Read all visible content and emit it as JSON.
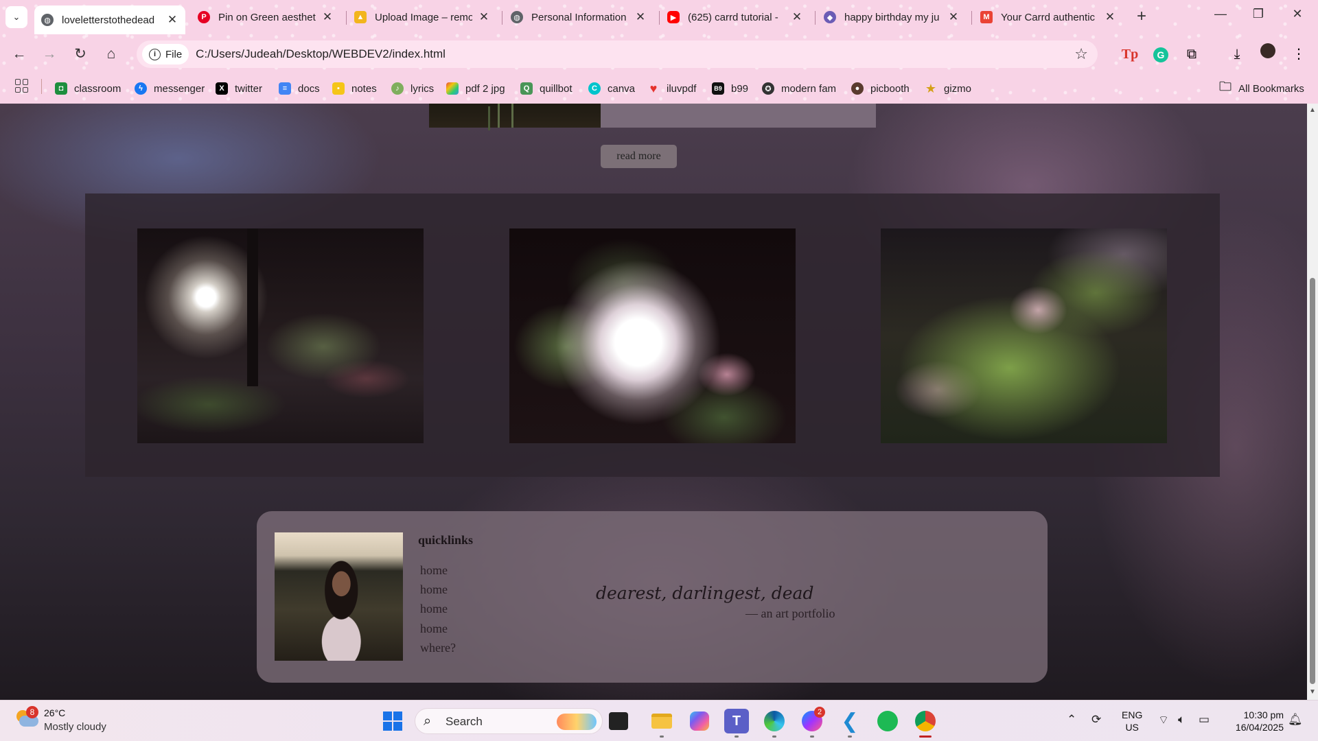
{
  "browser": {
    "tabs": [
      {
        "title": "loveletterstothedead",
        "active": true,
        "icon": "globe-icon",
        "color": "#5f6368"
      },
      {
        "title": "Pin on Green aesthet",
        "active": false,
        "icon": "pinterest-icon",
        "color": "#e60023"
      },
      {
        "title": "Upload Image – remo",
        "active": false,
        "icon": "upload-icon",
        "color": "#f2b51d"
      },
      {
        "title": "Personal Information",
        "active": false,
        "icon": "globe-icon",
        "color": "#5f6368"
      },
      {
        "title": "(625) carrd tutorial -",
        "active": false,
        "icon": "youtube-icon",
        "color": "#ff0000"
      },
      {
        "title": "happy birthday my ju",
        "active": false,
        "icon": "app-icon",
        "color": "#6b5cb5"
      },
      {
        "title": "Your Carrd authentic",
        "active": false,
        "icon": "gmail-icon",
        "color": "#ea4335"
      }
    ],
    "address": {
      "chip_label": "File",
      "url": "C:/Users/Judeah/Desktop/WEBDEV2/index.html"
    },
    "bookmarks": [
      {
        "label": "classroom",
        "icon": "classroom-icon",
        "color": "#1e8e3e"
      },
      {
        "label": "messenger",
        "icon": "messenger-icon",
        "color": "#1877f2"
      },
      {
        "label": "twitter",
        "icon": "x-icon",
        "color": "#000000"
      },
      {
        "label": "docs",
        "icon": "docs-icon",
        "color": "#4285f4"
      },
      {
        "label": "notes",
        "icon": "notes-icon",
        "color": "#f5c518"
      },
      {
        "label": "lyrics",
        "icon": "lyrics-icon",
        "color": "#7fae5d"
      },
      {
        "label": "pdf 2 jpg",
        "icon": "pdf-icon",
        "color": "#8e44ad"
      },
      {
        "label": "quillbot",
        "icon": "quillbot-icon",
        "color": "#499557"
      },
      {
        "label": "canva",
        "icon": "canva-icon",
        "color": "#00c4cc"
      },
      {
        "label": "iluvpdf",
        "icon": "heart-icon",
        "color": "#e5322d"
      },
      {
        "label": "b99",
        "icon": "b99-icon",
        "color": "#111111"
      },
      {
        "label": "modern fam",
        "icon": "film-icon",
        "color": "#333333"
      },
      {
        "label": "picbooth",
        "icon": "person-icon",
        "color": "#5a3b2e"
      },
      {
        "label": "gizmo",
        "icon": "star-icon",
        "color": "#d4a017"
      }
    ],
    "all_bookmarks_label": "All Bookmarks"
  },
  "page": {
    "read_more_label": "read more",
    "quicklinks": {
      "title": "quicklinks",
      "links": [
        "home",
        "home",
        "home",
        "home",
        "where?"
      ]
    },
    "tagline": "dearest, darlingest, dead",
    "subtagline": "— an art portfolio"
  },
  "taskbar": {
    "weather": {
      "badge": "8",
      "temp": "26°C",
      "desc": "Mostly cloudy"
    },
    "search_label": "Search",
    "messenger_badge": "2",
    "lang_primary": "ENG",
    "lang_secondary": "US",
    "time": "10:30 pm",
    "date": "16/04/2025"
  }
}
